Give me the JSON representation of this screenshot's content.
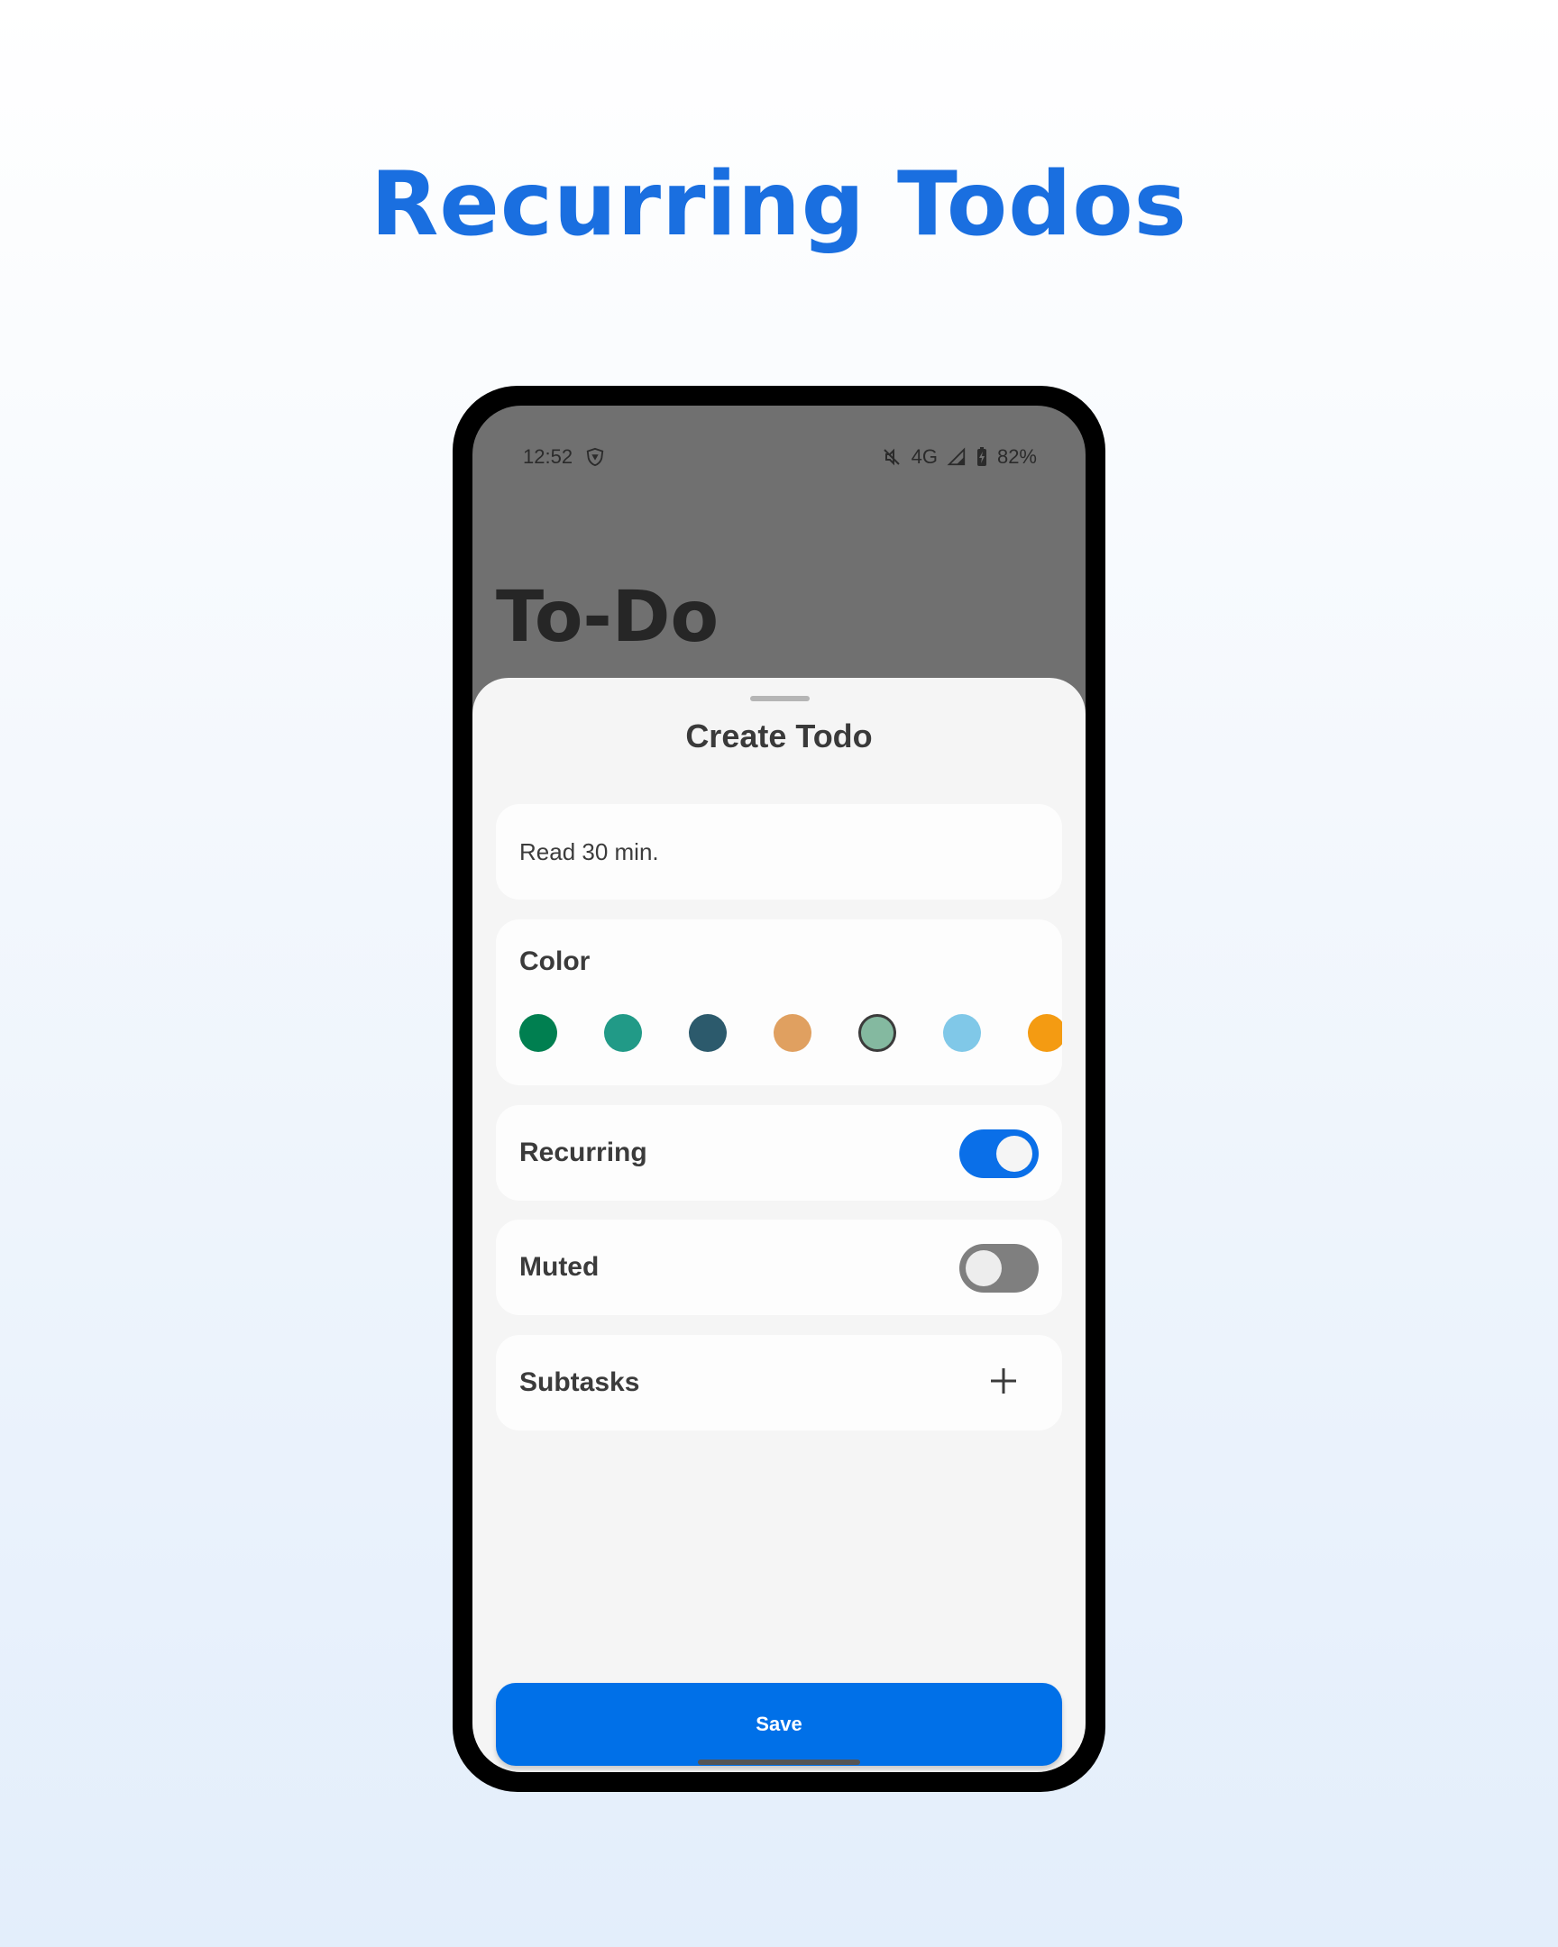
{
  "headline": "Recurring Todos",
  "status_bar": {
    "time": "12:52",
    "vpn_icon": "shield-icon",
    "network": "4G",
    "battery": "82%"
  },
  "app": {
    "title": "To-Do"
  },
  "sheet": {
    "title": "Create Todo",
    "todo_text": "Read 30 min.",
    "color_label": "Color",
    "colors": [
      "#007f50",
      "#219a87",
      "#2c5a6c",
      "#e0a060",
      "#84b9a0",
      "#80c8e8",
      "#f49b12"
    ],
    "selected_color_index": 4,
    "recurring_label": "Recurring",
    "recurring_on": true,
    "muted_label": "Muted",
    "muted_on": false,
    "subtasks_label": "Subtasks",
    "save_label": "Save"
  },
  "accent_color": "#0070e8"
}
